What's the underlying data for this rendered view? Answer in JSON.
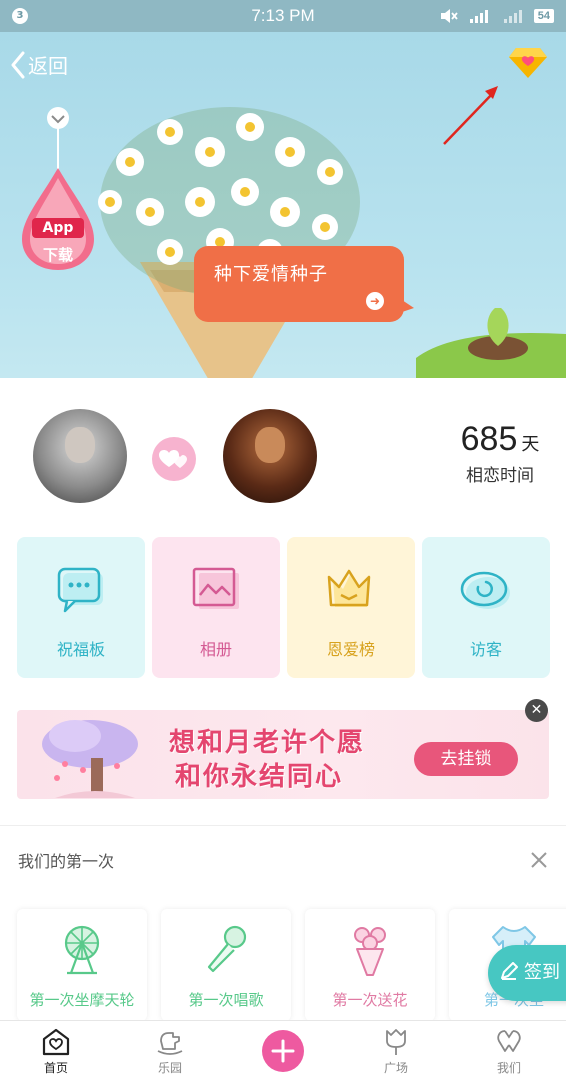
{
  "status_bar": {
    "notification_count": "3",
    "time": "7:13 PM",
    "battery": "54",
    "icons": [
      "mute-icon",
      "signal-4g-icon",
      "signal-icon",
      "battery-icon"
    ]
  },
  "header": {
    "back_label": "返回",
    "diamond_icon": "diamond-heart-icon"
  },
  "app_badge": {
    "top": "App",
    "bottom": "下载"
  },
  "hero": {
    "bubble_text": "种下爱情种子"
  },
  "couple": {
    "days_value": "685",
    "days_unit": "天",
    "days_label": "相恋时间"
  },
  "features": [
    {
      "label": "祝福板",
      "icon": "chat-bubble-icon"
    },
    {
      "label": "相册",
      "icon": "photo-album-icon"
    },
    {
      "label": "恩爱榜",
      "icon": "crown-icon"
    },
    {
      "label": "访客",
      "icon": "eye-icon"
    }
  ],
  "banner": {
    "line1": "想和月老许个愿",
    "line2": "和你永结同心",
    "cta": "去挂锁",
    "close": "✕"
  },
  "firsts": {
    "title": "我们的第一次",
    "items": [
      {
        "label": "第一次坐摩天轮",
        "icon": "ferris-wheel-icon"
      },
      {
        "label": "第一次唱歌",
        "icon": "microphone-icon"
      },
      {
        "label": "第一次送花",
        "icon": "bouquet-icon"
      },
      {
        "label": "第一次坐",
        "icon": "clothes-icon"
      }
    ]
  },
  "checkin": {
    "label": "签到"
  },
  "bottom_nav": [
    {
      "label": "首页",
      "icon": "home-heart-icon"
    },
    {
      "label": "乐园",
      "icon": "rocking-horse-icon"
    },
    {
      "label": "",
      "icon": "plus-icon"
    },
    {
      "label": "广场",
      "icon": "tulip-icon"
    },
    {
      "label": "我们",
      "icon": "couple-rings-icon"
    }
  ],
  "colors": {
    "accent_pink": "#ee5aa0",
    "bubble_orange": "#f06f47",
    "teal": "#47c7c2"
  }
}
